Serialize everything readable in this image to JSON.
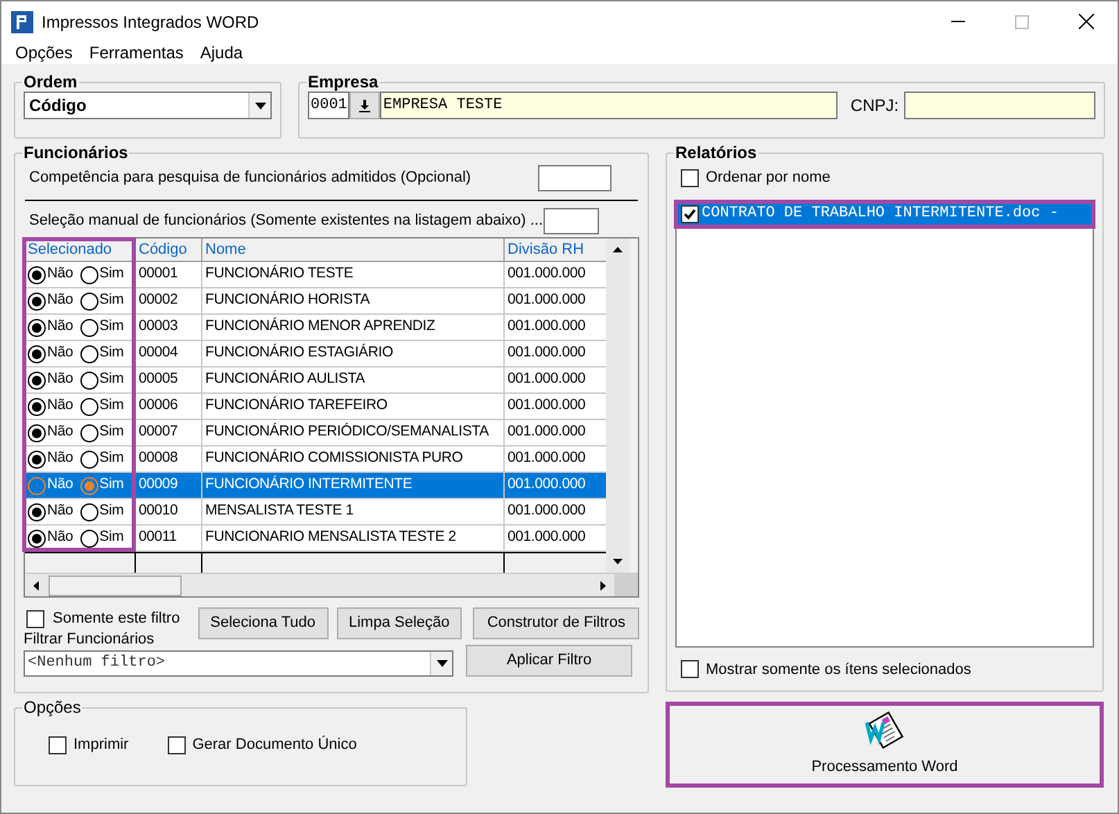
{
  "window": {
    "title": "Impressos Integrados WORD"
  },
  "menu": [
    "Opções",
    "Ferramentas",
    "Ajuda"
  ],
  "ordem": {
    "label": "Ordem",
    "value": "Código"
  },
  "empresa": {
    "label": "Empresa",
    "code": "0001",
    "name": "EMPRESA TESTE",
    "cnpj_label": "CNPJ:"
  },
  "funcionarios": {
    "label": "Funcionários",
    "competencia_label": "Competência para pesquisa de funcionários admitidos (Opcional)",
    "selecao_label": "Seleção manual de funcionários (Somente existentes na listagem abaixo) ...",
    "table": {
      "selection_column_highlighted": true,
      "columns": [
        {
          "label": "Selecionado"
        },
        {
          "label": "Código"
        },
        {
          "label": "Nome"
        },
        {
          "label": "Divisão RH"
        }
      ],
      "rows": [
        {
          "selected": false,
          "options": [
            {
              "label": "Não",
              "selected": true
            },
            {
              "label": "Sim",
              "selected": false
            }
          ],
          "code": "00001",
          "name": "FUNCIONÁRIO TESTE",
          "division": "001.000.000"
        },
        {
          "selected": false,
          "options": [
            {
              "label": "Não",
              "selected": true
            },
            {
              "label": "Sim",
              "selected": false
            }
          ],
          "code": "00002",
          "name": "FUNCIONÁRIO HORISTA",
          "division": "001.000.000"
        },
        {
          "selected": false,
          "options": [
            {
              "label": "Não",
              "selected": true
            },
            {
              "label": "Sim",
              "selected": false
            }
          ],
          "code": "00003",
          "name": "FUNCIONÁRIO MENOR APRENDIZ",
          "division": "001.000.000"
        },
        {
          "selected": false,
          "options": [
            {
              "label": "Não",
              "selected": true
            },
            {
              "label": "Sim",
              "selected": false
            }
          ],
          "code": "00004",
          "name": "FUNCIONÁRIO ESTAGIÁRIO",
          "division": "001.000.000"
        },
        {
          "selected": false,
          "options": [
            {
              "label": "Não",
              "selected": true
            },
            {
              "label": "Sim",
              "selected": false
            }
          ],
          "code": "00005",
          "name": "FUNCIONÁRIO AULISTA",
          "division": "001.000.000"
        },
        {
          "selected": false,
          "options": [
            {
              "label": "Não",
              "selected": true
            },
            {
              "label": "Sim",
              "selected": false
            }
          ],
          "code": "00006",
          "name": "FUNCIONÁRIO TAREFEIRO",
          "division": "001.000.000"
        },
        {
          "selected": false,
          "options": [
            {
              "label": "Não",
              "selected": true
            },
            {
              "label": "Sim",
              "selected": false
            }
          ],
          "code": "00007",
          "name": "FUNCIONÁRIO PERIÓDICO/SEMANALISTA",
          "division": "001.000.000"
        },
        {
          "selected": false,
          "options": [
            {
              "label": "Não",
              "selected": true
            },
            {
              "label": "Sim",
              "selected": false
            }
          ],
          "code": "00008",
          "name": "FUNCIONÁRIO COMISSIONISTA PURO",
          "division": "001.000.000"
        },
        {
          "selected": true,
          "options": [
            {
              "label": "Não",
              "selected": false
            },
            {
              "label": "Sim",
              "selected": true
            }
          ],
          "code": "00009",
          "name": "FUNCIONÁRIO INTERMITENTE",
          "division": "001.000.000"
        },
        {
          "selected": false,
          "options": [
            {
              "label": "Não",
              "selected": true
            },
            {
              "label": "Sim",
              "selected": false
            }
          ],
          "code": "00010",
          "name": "MENSALISTA TESTE 1",
          "division": "001.000.000"
        },
        {
          "selected": false,
          "options": [
            {
              "label": "Não",
              "selected": true
            },
            {
              "label": "Sim",
              "selected": false
            }
          ],
          "code": "00011",
          "name": "FUNCIONARIO MENSALISTA TESTE 2",
          "division": "001.000.000"
        }
      ]
    },
    "somente_filtro": {
      "label": "Somente este filtro",
      "checked": false
    },
    "buttons": [
      "Seleciona Tudo",
      "Limpa Seleção",
      "Construtor de Filtros"
    ],
    "filtrar_label": "Filtrar Funcionários",
    "filter_value": "<Nenhum filtro>",
    "apply_button": "Aplicar Filtro"
  },
  "opcoes": {
    "label": "Opções",
    "checks": [
      {
        "label": "Imprimir",
        "checked": false
      },
      {
        "label": "Gerar Documento Único",
        "checked": false
      }
    ]
  },
  "relatorios": {
    "label": "Relatórios",
    "ordenar": {
      "label": "Ordenar por nome",
      "checked": false
    },
    "items": [
      {
        "label": "CONTRATO DE TRABALHO INTERMITENTE.doc -",
        "checked": true,
        "selected": true,
        "highlighted": true
      }
    ],
    "mostrar": {
      "label": "Mostrar somente os ítens selecionados",
      "checked": false
    }
  },
  "process_button": {
    "label": "Processamento Word",
    "highlighted": true
  }
}
